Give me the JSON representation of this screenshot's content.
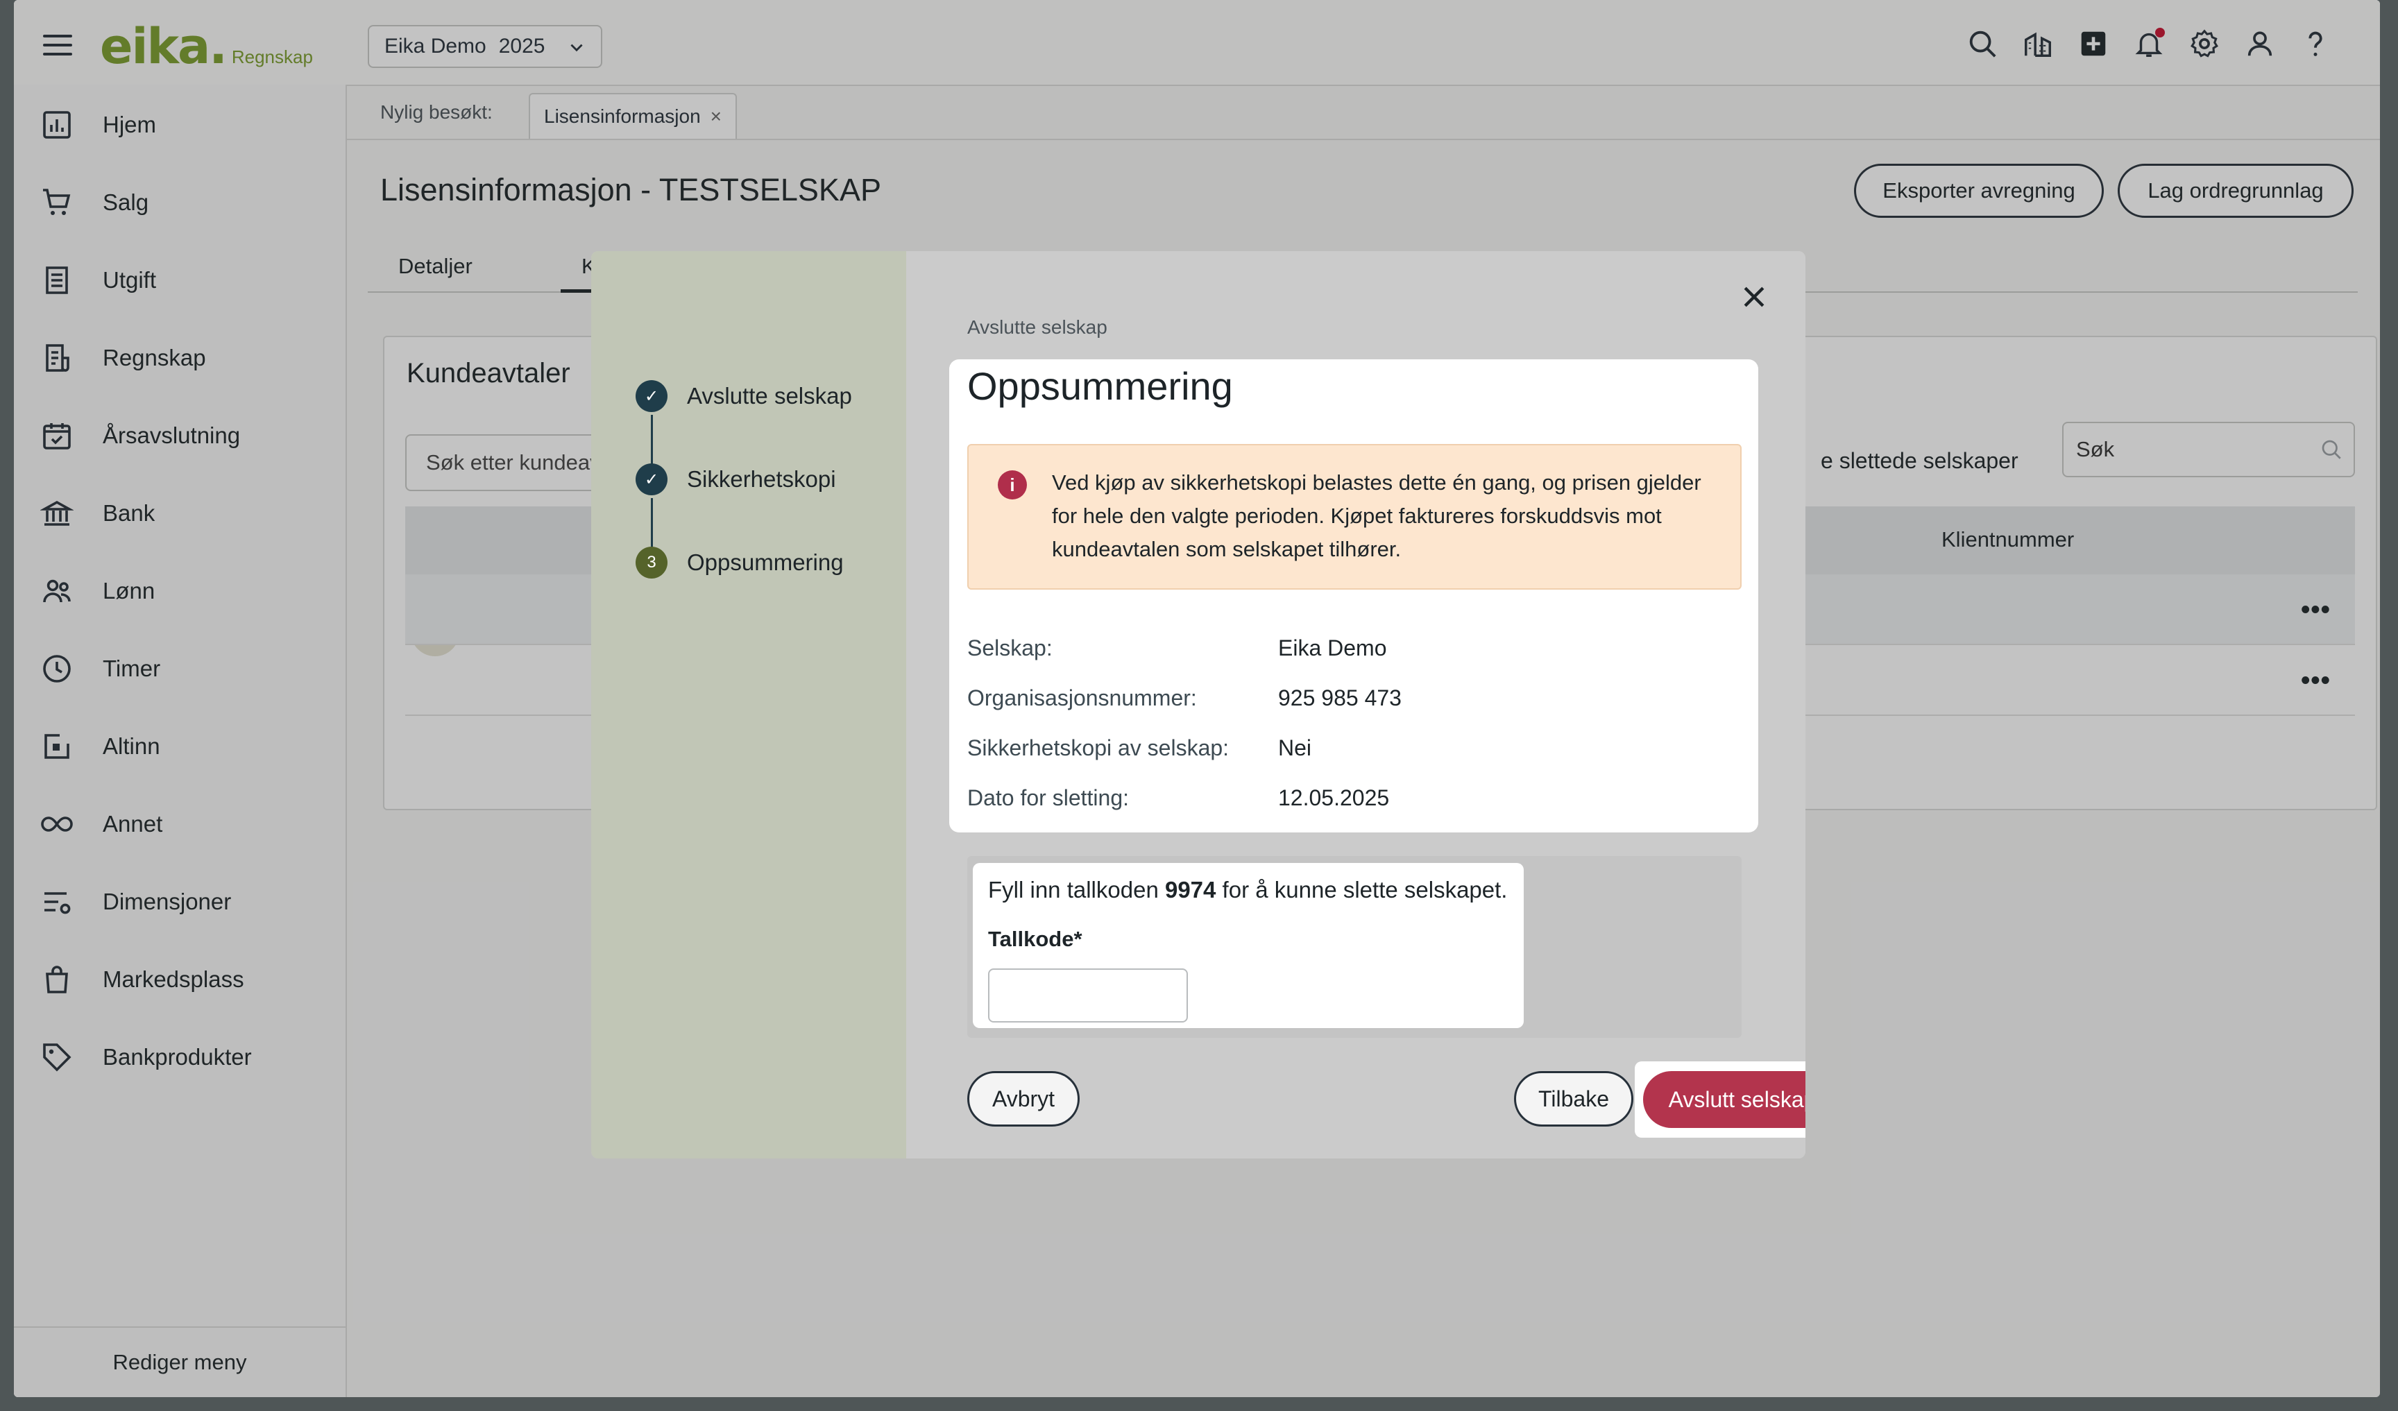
{
  "app": {
    "logo_text": "eika.",
    "logo_sub": "Regnskap",
    "company": "Eika Demo",
    "year": "2025",
    "top_icons": [
      "search-icon",
      "buildings-icon",
      "plus-square-icon",
      "bell-icon",
      "gear-icon",
      "user-icon",
      "help-icon"
    ],
    "notification_dot_color": "#c8102e"
  },
  "sidebar": {
    "items": [
      {
        "label": "Hjem",
        "icon": "chart-icon"
      },
      {
        "label": "Salg",
        "icon": "cart-icon"
      },
      {
        "label": "Utgift",
        "icon": "receipt-icon"
      },
      {
        "label": "Regnskap",
        "icon": "ledger-icon"
      },
      {
        "label": "Årsavslutning",
        "icon": "calendar-check-icon"
      },
      {
        "label": "Bank",
        "icon": "bank-icon"
      },
      {
        "label": "Lønn",
        "icon": "people-icon"
      },
      {
        "label": "Timer",
        "icon": "clock-icon"
      },
      {
        "label": "Altinn",
        "icon": "altinn-icon"
      },
      {
        "label": "Annet",
        "icon": "infinity-icon"
      },
      {
        "label": "Dimensjoner",
        "icon": "sliders-icon"
      },
      {
        "label": "Markedsplass",
        "icon": "bag-icon"
      },
      {
        "label": "Bankprodukter",
        "icon": "tag-icon"
      }
    ],
    "footer": "Rediger meny"
  },
  "main": {
    "recent_label": "Nylig besøkt:",
    "recent_tab": "Lisensinformasjon",
    "title": "Lisensinformasjon - TESTSELSKAP",
    "export_button": "Eksporter avregning",
    "order_button": "Lag ordregrunnlag",
    "tabs": [
      "Detaljer",
      "Kund"
    ],
    "card_title": "Kundeavtaler",
    "card_search": "Søk etter kundeav",
    "deleted_label": "e slettede selskaper",
    "search_placeholder": "Søk",
    "column_client": "Klientnummer",
    "row_marker": "#",
    "row_menu": "•••"
  },
  "modal": {
    "steps": [
      {
        "label": "Avslutte selskap",
        "state": "done"
      },
      {
        "label": "Sikkerhetskopi",
        "state": "done"
      },
      {
        "label": "Oppsummering",
        "state": "current",
        "number": "3"
      }
    ],
    "breadcrumb": "Avslutte selskap",
    "heading": "Oppsummering",
    "info_text": "Ved kjøp av sikkerhetskopi belastes dette én gang, og prisen gjelder for hele den valgte perioden. Kjøpet faktureres forskuddsvis mot kundeavtalen som selskapet tilhører.",
    "info_icon": "i",
    "fields": [
      {
        "label": "Selskap:",
        "value": "Eika Demo"
      },
      {
        "label": "Organisasjonsnummer:",
        "value": "925 985 473"
      },
      {
        "label": "Sikkerhetskopi av selskap:",
        "value": "Nei"
      },
      {
        "label": "Dato for sletting:",
        "value": "12.05.2025"
      }
    ],
    "code_instr_pre": "Fyll inn tallkoden ",
    "code_value": "9974",
    "code_instr_post": " for å kunne slette selskapet.",
    "code_label": "Tallkode*",
    "code_input_value": "",
    "cancel_button": "Avbryt",
    "back_button": "Tilbake",
    "confirm_button": "Avslutt selskap",
    "confirm_color": "#b3344d"
  }
}
